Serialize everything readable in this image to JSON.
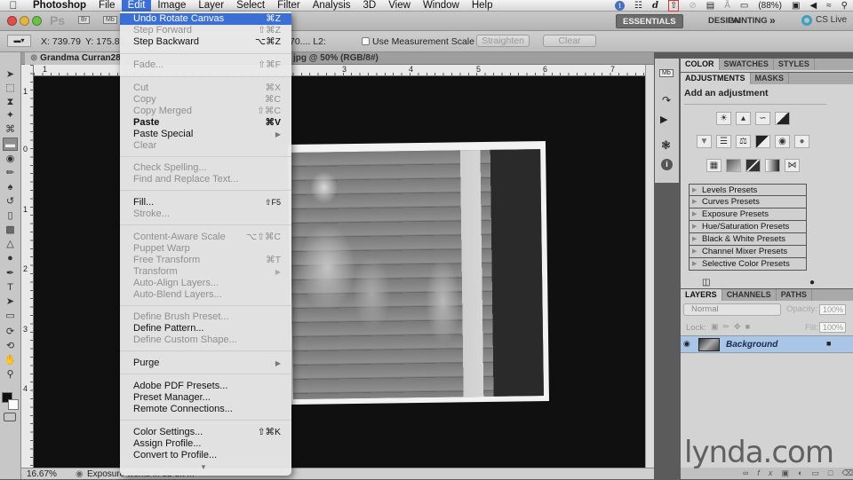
{
  "menubar": {
    "app": "Photoshop",
    "items": [
      "File",
      "Edit",
      "Image",
      "Layer",
      "Select",
      "Filter",
      "Analysis",
      "3D",
      "View",
      "Window",
      "Help"
    ],
    "active": "Edit",
    "battery": "(88%)"
  },
  "appbar": {
    "logo": "Ps",
    "bridge": "Br",
    "minibridge": "Mb",
    "workspaces": [
      "ESSENTIALS",
      "DESIGN",
      "PAINTING"
    ],
    "active_workspace": "ESSENTIALS",
    "more": "»",
    "cs_live": "CS Live"
  },
  "options": {
    "x": "X: 739.79",
    "y": "Y: 175.85",
    "tail": "70.... L2:",
    "use_measurement_scale": "Use Measurement Scale",
    "straighten": "Straighten",
    "clear": "Clear"
  },
  "document": {
    "tab_left": "Grandma Curran28",
    "tab_right": "jpg @ 50% (RGB/8#)",
    "ruler_h": [
      "1",
      "3",
      "4",
      "5",
      "6",
      "7"
    ],
    "ruler_v": [
      "1",
      "0",
      "1",
      "2",
      "3",
      "4"
    ]
  },
  "status": {
    "zoom": "16.67%",
    "message": "Exposure works in 32-bit ..."
  },
  "edit_menu": {
    "items": [
      {
        "label": "Undo Rotate Canvas",
        "shortcut": "⌘Z",
        "state": "highlighted"
      },
      {
        "label": "Step Forward",
        "shortcut": "⇧⌘Z",
        "state": "disabled"
      },
      {
        "label": "Step Backward",
        "shortcut": "⌥⌘Z",
        "state": "enabled"
      },
      {
        "label": "Fade...",
        "shortcut": "⇧⌘F",
        "state": "disabled"
      },
      {
        "label": "Cut",
        "shortcut": "⌘X",
        "state": "disabled"
      },
      {
        "label": "Copy",
        "shortcut": "⌘C",
        "state": "disabled"
      },
      {
        "label": "Copy Merged",
        "shortcut": "⇧⌘C",
        "state": "disabled"
      },
      {
        "label": "Paste",
        "shortcut": "⌘V",
        "state": "enabled"
      },
      {
        "label": "Paste Special",
        "shortcut": "▶",
        "state": "enabled"
      },
      {
        "label": "Clear",
        "shortcut": "",
        "state": "disabled"
      },
      {
        "label": "Check Spelling...",
        "shortcut": "",
        "state": "disabled"
      },
      {
        "label": "Find and Replace Text...",
        "shortcut": "",
        "state": "disabled"
      },
      {
        "label": "Fill...",
        "shortcut": "⇧F5",
        "state": "enabled"
      },
      {
        "label": "Stroke...",
        "shortcut": "",
        "state": "disabled"
      },
      {
        "label": "Content-Aware Scale",
        "shortcut": "⌥⇧⌘C",
        "state": "disabled"
      },
      {
        "label": "Puppet Warp",
        "shortcut": "",
        "state": "disabled"
      },
      {
        "label": "Free Transform",
        "shortcut": "⌘T",
        "state": "disabled"
      },
      {
        "label": "Transform",
        "shortcut": "▶",
        "state": "disabled"
      },
      {
        "label": "Auto-Align Layers...",
        "shortcut": "",
        "state": "disabled"
      },
      {
        "label": "Auto-Blend Layers...",
        "shortcut": "",
        "state": "disabled"
      },
      {
        "label": "Define Brush Preset...",
        "shortcut": "",
        "state": "disabled"
      },
      {
        "label": "Define Pattern...",
        "shortcut": "",
        "state": "enabled"
      },
      {
        "label": "Define Custom Shape...",
        "shortcut": "",
        "state": "disabled"
      },
      {
        "label": "Purge",
        "shortcut": "▶",
        "state": "enabled"
      },
      {
        "label": "Adobe PDF Presets...",
        "shortcut": "",
        "state": "enabled"
      },
      {
        "label": "Preset Manager...",
        "shortcut": "",
        "state": "enabled"
      },
      {
        "label": "Remote Connections...",
        "shortcut": "",
        "state": "enabled"
      },
      {
        "label": "Color Settings...",
        "shortcut": "⇧⌘K",
        "state": "enabled"
      },
      {
        "label": "Assign Profile...",
        "shortcut": "",
        "state": "enabled"
      },
      {
        "label": "Convert to Profile...",
        "shortcut": "",
        "state": "enabled"
      }
    ],
    "more_arrow": "▼"
  },
  "panels": {
    "color_tabs": [
      "COLOR",
      "SWATCHES",
      "STYLES"
    ],
    "adjust_tabs": [
      "ADJUSTMENTS",
      "MASKS"
    ],
    "adjust_heading": "Add an adjustment",
    "presets": [
      "Levels Presets",
      "Curves Presets",
      "Exposure Presets",
      "Hue/Saturation Presets",
      "Black & White Presets",
      "Channel Mixer Presets",
      "Selective Color Presets"
    ],
    "layers_tabs": [
      "LAYERS",
      "CHANNELS",
      "PATHS"
    ],
    "blend_mode": "Normal",
    "opacity_label": "Opacity:",
    "opacity": "100%",
    "lock_label": "Lock:",
    "fill_label": "Fill:",
    "fill": "100%",
    "layer_name": "Background"
  },
  "watermark": "lynda.com",
  "colors": {
    "menu_highlight": "#3b6fd6",
    "layer_selected": "#a9c6e8"
  }
}
